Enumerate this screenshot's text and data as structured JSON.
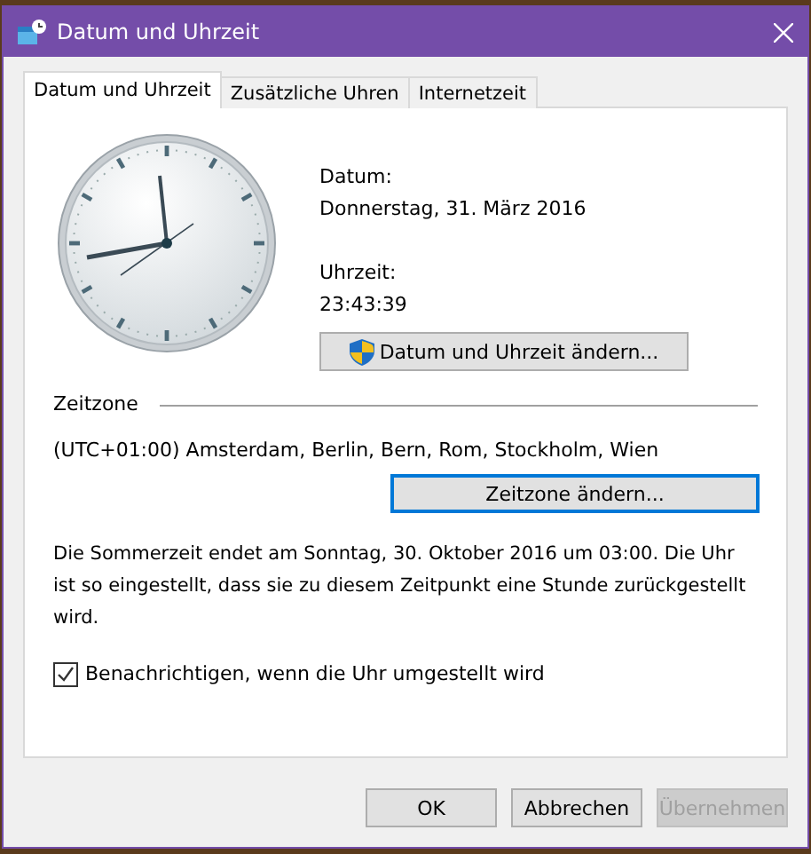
{
  "window": {
    "title": "Datum und Uhrzeit"
  },
  "tabs": [
    {
      "label": "Datum und Uhrzeit",
      "selected": true
    },
    {
      "label": "Zusätzliche Uhren",
      "selected": false
    },
    {
      "label": "Internetzeit",
      "selected": false
    }
  ],
  "date": {
    "label": "Datum:",
    "value": "Donnerstag, 31. März 2016"
  },
  "time": {
    "label": "Uhrzeit:",
    "value": "23:43:39"
  },
  "change_datetime_button": {
    "label": "Datum und Uhrzeit ändern..."
  },
  "timezone": {
    "heading": "Zeitzone",
    "value": "(UTC+01:00) Amsterdam, Berlin, Bern, Rom, Stockholm, Wien",
    "button": {
      "label": "Zeitzone ändern...",
      "focused": true
    }
  },
  "dst_note": "Die Sommerzeit endet am Sonntag, 30. Oktober 2016 um 03:00. Die Uhr ist so eingestellt, dass sie zu diesem Zeitpunkt eine Stunde zurückgestellt wird.",
  "notify": {
    "label": "Benachrichtigen, wenn die Uhr umgestellt wird",
    "checked": true
  },
  "buttons": [
    {
      "label": "OK",
      "disabled": false
    },
    {
      "label": "Abbrechen",
      "disabled": false
    },
    {
      "label": "Übernehmen",
      "disabled": true
    }
  ]
}
